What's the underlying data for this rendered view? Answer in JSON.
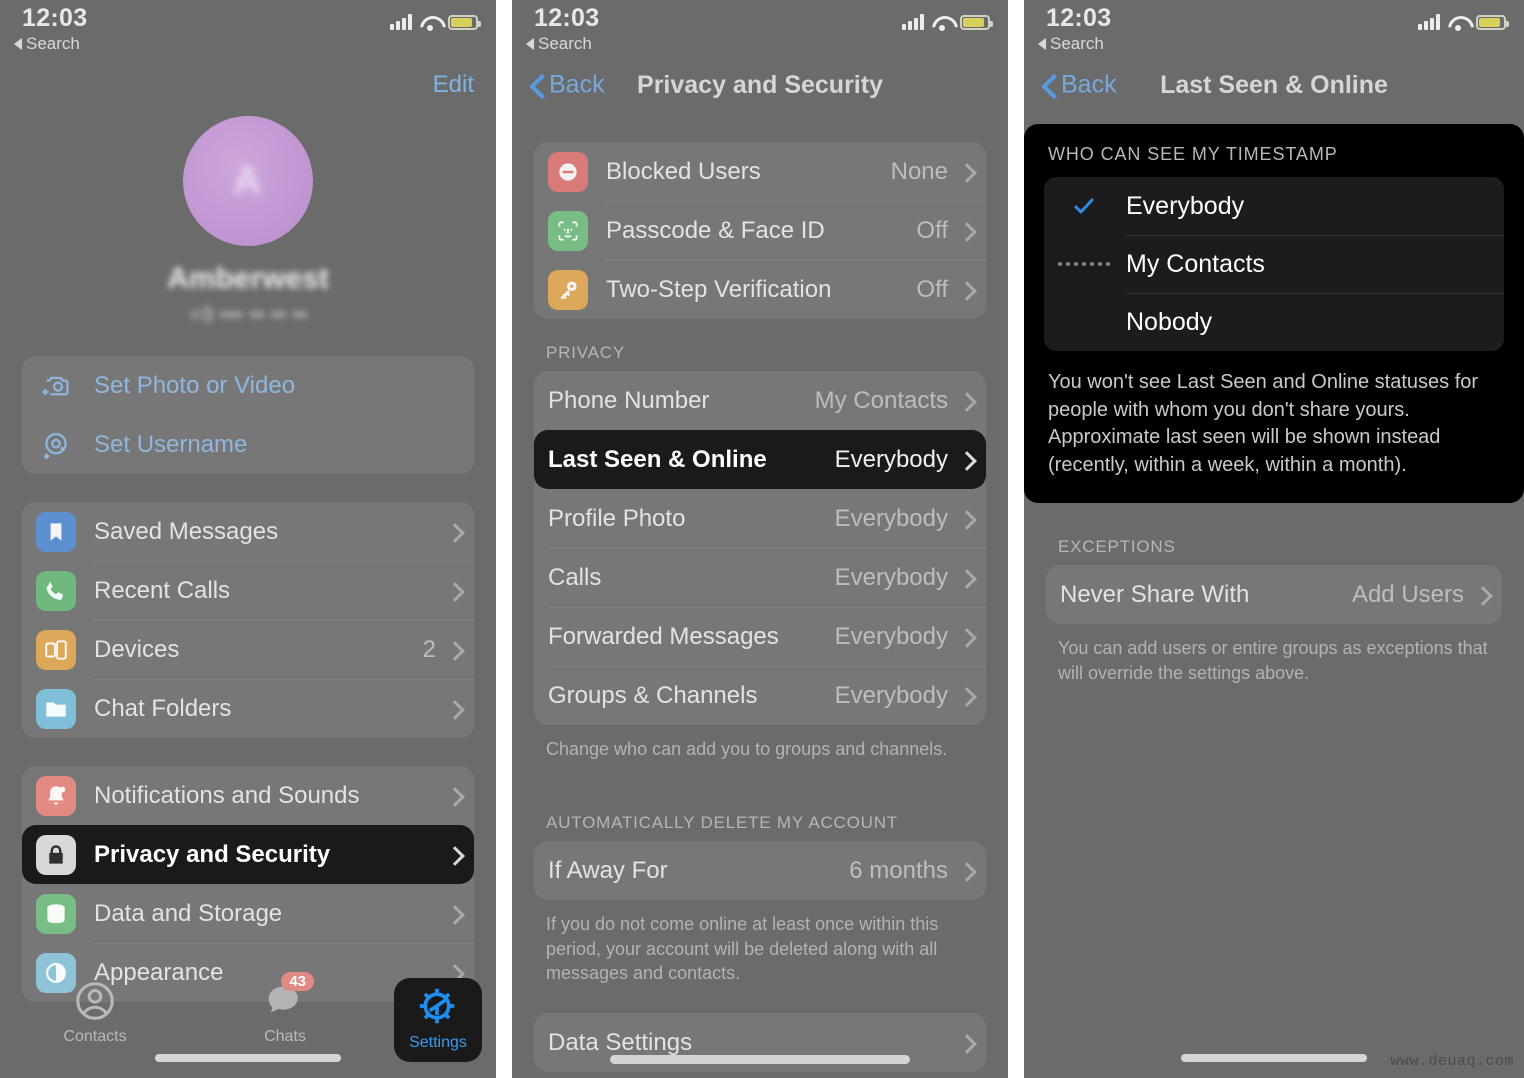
{
  "status_bar": {
    "time": "12:03",
    "back_label": "Search",
    "signal_icon": "cellular-signal-icon",
    "wifi_icon": "wifi-icon",
    "battery_icon": "battery-icon"
  },
  "panel1": {
    "nav": {
      "edit_label": "Edit"
    },
    "profile": {
      "avatar_initials": "A",
      "name": "Amberwest",
      "phone": "+9  ••• ••  •• ••"
    },
    "setup_rows": [
      {
        "label": "Set Photo or Video",
        "icon": "camera-plus-icon"
      },
      {
        "label": "Set Username",
        "icon": "at-plus-icon"
      }
    ],
    "main_rows": [
      {
        "label": "Saved Messages",
        "value": "",
        "icon": "bookmark-icon",
        "color": "#5b8fd0"
      },
      {
        "label": "Recent Calls",
        "value": "",
        "icon": "phone-icon",
        "color": "#6fb97e"
      },
      {
        "label": "Devices",
        "value": "2",
        "icon": "devices-icon",
        "color": "#dda85a"
      },
      {
        "label": "Chat Folders",
        "value": "",
        "icon": "folder-icon",
        "color": "#7fc0d8"
      }
    ],
    "settings_rows": [
      {
        "label": "Notifications and Sounds",
        "value": "",
        "icon": "bell-icon",
        "color": "#e08a82",
        "selected": false
      },
      {
        "label": "Privacy and Security",
        "value": "",
        "icon": "lock-icon",
        "color": "#d8d8d8",
        "selected": true
      },
      {
        "label": "Data and Storage",
        "value": "",
        "icon": "database-icon",
        "color": "#79bd86",
        "selected": false
      },
      {
        "label": "Appearance",
        "value": "",
        "icon": "contrast-icon",
        "color": "#8fc3d8",
        "selected": false
      }
    ],
    "tabs": [
      {
        "label": "Contacts",
        "icon": "contacts-icon",
        "badge": "",
        "active": false
      },
      {
        "label": "Chats",
        "icon": "chats-icon",
        "badge": "43",
        "active": false
      },
      {
        "label": "Settings",
        "icon": "gear-icon",
        "badge": "",
        "active": true
      }
    ]
  },
  "panel2": {
    "nav": {
      "back_label": "Back",
      "title": "Privacy and Security"
    },
    "security_rows": [
      {
        "label": "Blocked Users",
        "value": "None",
        "icon": "block-icon",
        "color": "#d97b78"
      },
      {
        "label": "Passcode & Face ID",
        "value": "Off",
        "icon": "faceid-icon",
        "color": "#79bd86"
      },
      {
        "label": "Two-Step Verification",
        "value": "Off",
        "icon": "key-icon",
        "color": "#dda85a"
      }
    ],
    "privacy_header": "PRIVACY",
    "privacy_rows": [
      {
        "label": "Phone Number",
        "value": "My Contacts",
        "selected": false
      },
      {
        "label": "Last Seen & Online",
        "value": "Everybody",
        "selected": true
      },
      {
        "label": "Profile Photo",
        "value": "Everybody",
        "selected": false
      },
      {
        "label": "Calls",
        "value": "Everybody",
        "selected": false
      },
      {
        "label": "Forwarded Messages",
        "value": "Everybody",
        "selected": false
      },
      {
        "label": "Groups & Channels",
        "value": "Everybody",
        "selected": false
      }
    ],
    "privacy_note": "Change who can add you to groups and channels.",
    "delete_header": "AUTOMATICALLY DELETE MY ACCOUNT",
    "delete_row": {
      "label": "If Away For",
      "value": "6 months"
    },
    "delete_note": "If you do not come online at least once within this period, your account will be deleted along with all messages and contacts.",
    "data_row": {
      "label": "Data Settings",
      "value": ""
    }
  },
  "panel3": {
    "nav": {
      "back_label": "Back",
      "title": "Last Seen & Online"
    },
    "popup_header": "WHO CAN SEE MY TIMESTAMP",
    "options": [
      {
        "label": "Everybody",
        "checked": true,
        "cursor": false
      },
      {
        "label": "My Contacts",
        "checked": false,
        "cursor": true
      },
      {
        "label": "Nobody",
        "checked": false,
        "cursor": false
      }
    ],
    "popup_note": "You won't see Last Seen and Online statuses for people with whom you don't share yours. Approximate last seen will be shown instead (recently, within a week, within a month).",
    "exceptions_header": "EXCEPTIONS",
    "exception_row": {
      "label": "Never Share With",
      "value": "Add Users"
    },
    "exceptions_note": "You can add users or entire groups as exceptions that will override the settings above."
  },
  "watermark": "www.deuaq.com",
  "colors": {
    "accent_blue": "#3a9bf0",
    "highlight_bg": "#1a1a1a",
    "panel_bg": "#6b6b6b",
    "check_blue": "#2f8ae0"
  }
}
